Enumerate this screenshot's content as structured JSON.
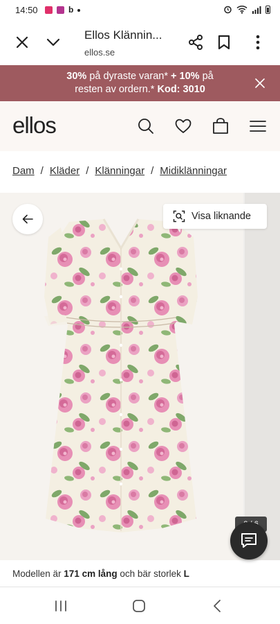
{
  "status_bar": {
    "time": "14:50",
    "b_label": "b"
  },
  "browser": {
    "title": "Ellos Klännin...",
    "url": "ellos.se"
  },
  "promo": {
    "line1_bold": "30%",
    "line1_rest": " på dyraste varan* ",
    "line1_bold2": "+ 10%",
    "line1_tail": " på",
    "line2_rest": "resten av ordern.* ",
    "line2_bold": "Kod: 3010"
  },
  "header": {
    "logo": "ellos"
  },
  "breadcrumb": [
    "Dam",
    "Kläder",
    "Klänningar",
    "Midiklänningar"
  ],
  "breadcrumb_separator": "/",
  "gallery": {
    "similar_label": "Visa liknande",
    "counter": "2 / 6"
  },
  "model_info": {
    "prefix": "Modellen är ",
    "height": "171 cm lång",
    "middle": " och bär storlek ",
    "size": "L"
  },
  "colors": {
    "promo_bg": "#9e5a5f",
    "header_bg": "#fbf7f4",
    "dress_base": "#f4efe2",
    "flower_pink": "#e78fb5",
    "leaf_green": "#7fa86a"
  }
}
